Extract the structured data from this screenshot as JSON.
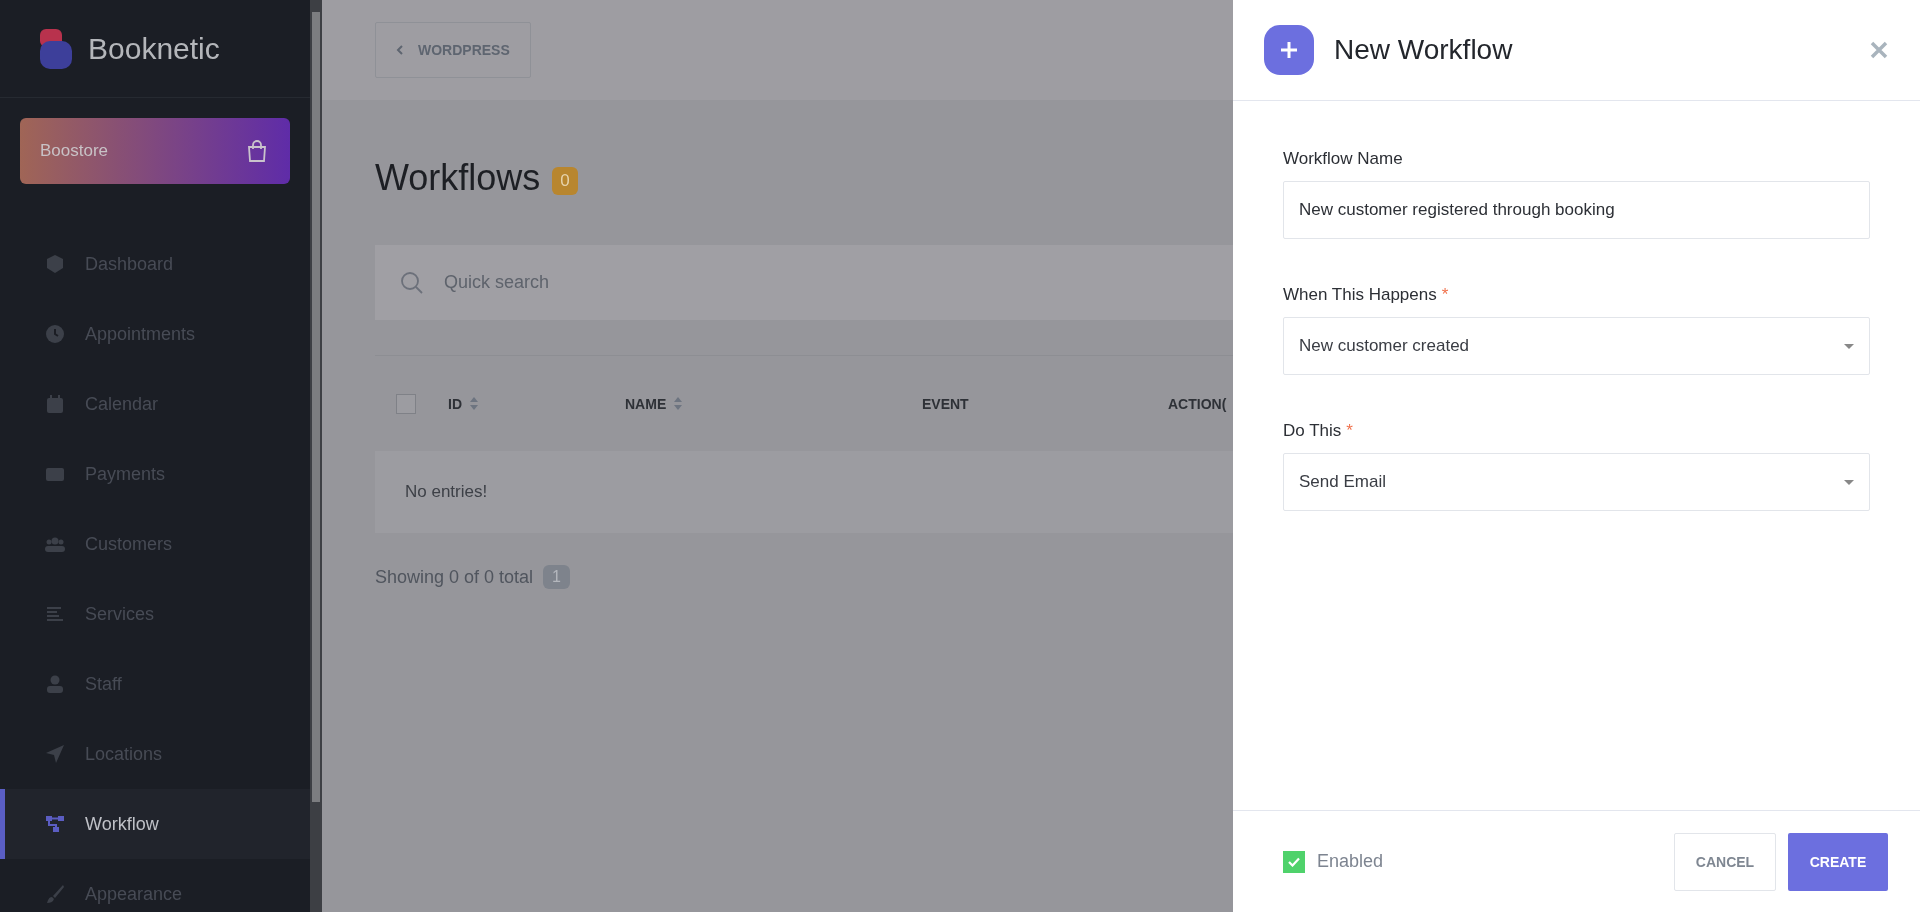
{
  "sidebar": {
    "logo": "Booknetic",
    "store_button": "Boostore",
    "items": [
      {
        "label": "Dashboard",
        "selected": false
      },
      {
        "label": "Appointments",
        "selected": false
      },
      {
        "label": "Calendar",
        "selected": false
      },
      {
        "label": "Payments",
        "selected": false
      },
      {
        "label": "Customers",
        "selected": false
      },
      {
        "label": "Services",
        "selected": false
      },
      {
        "label": "Staff",
        "selected": false
      },
      {
        "label": "Locations",
        "selected": false
      },
      {
        "label": "Workflow",
        "selected": true
      },
      {
        "label": "Appearance",
        "selected": false
      }
    ]
  },
  "main": {
    "back_button": "WORDPRESS",
    "title": "Workflows",
    "count": "0",
    "search": {
      "placeholder": "Quick search"
    },
    "table": {
      "select_all": {
        "checked": false
      },
      "columns": [
        {
          "label": "ID",
          "sortable": true
        },
        {
          "label": "NAME",
          "sortable": true
        },
        {
          "label": "EVENT",
          "sortable": false
        },
        {
          "label": "ACTION(",
          "sortable": false
        }
      ],
      "empty_message": "No entries!"
    },
    "pagination": {
      "summary": "Showing 0 of 0 total",
      "pages": [
        {
          "label": "1",
          "selected": true
        }
      ]
    }
  },
  "panel": {
    "title": "New Workflow",
    "fields": [
      {
        "kind": "text",
        "label": "Workflow Name",
        "value": "New customer registered through booking"
      },
      {
        "kind": "select",
        "label": "When This Happens",
        "marker": "*",
        "value": "New customer created"
      },
      {
        "kind": "select",
        "label": "Do This",
        "marker": "*",
        "value": "Send Email"
      }
    ],
    "enabled": {
      "label": "Enabled",
      "checked": true
    },
    "buttons": [
      {
        "kind": "secondary",
        "label": "CANCEL"
      },
      {
        "kind": "primary",
        "label": "CREATE"
      }
    ]
  }
}
